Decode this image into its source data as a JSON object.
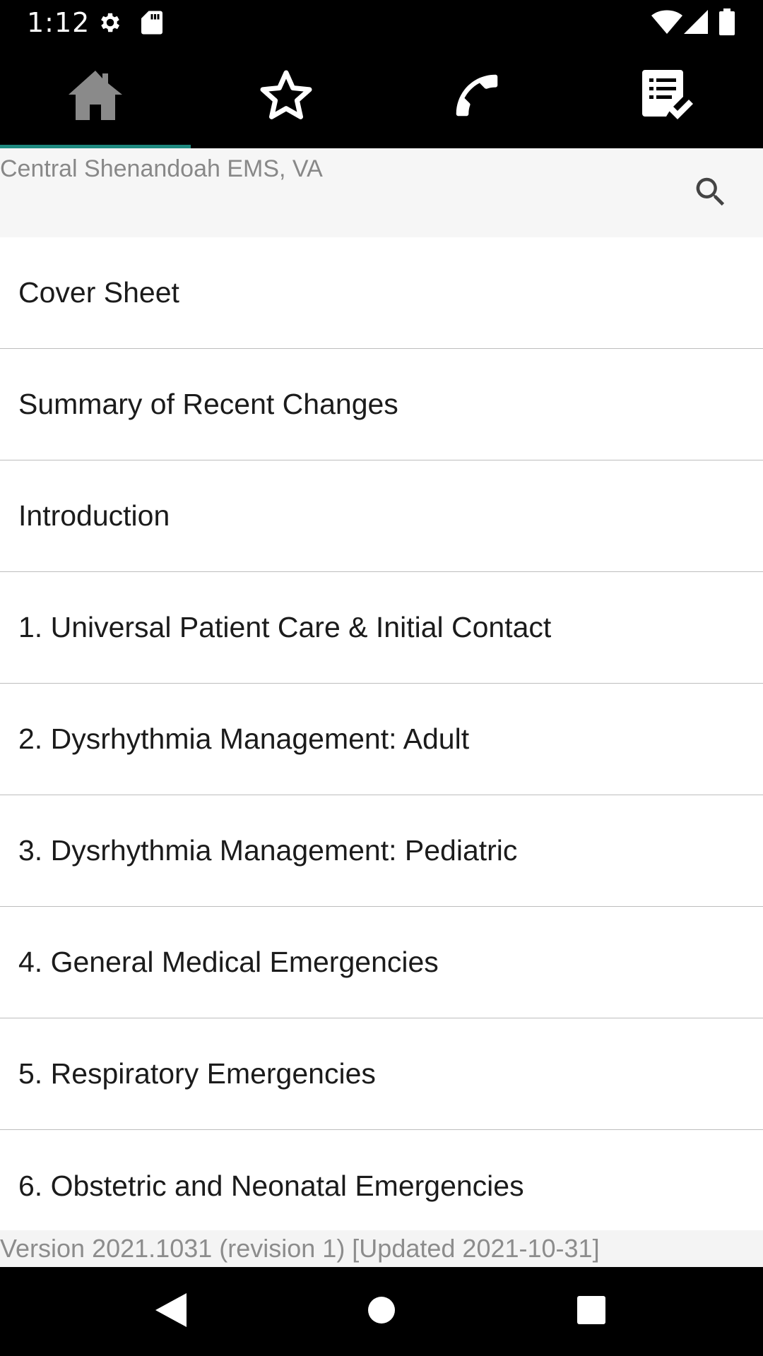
{
  "status_bar": {
    "time": "1:12",
    "icons": [
      "settings-gear-icon",
      "sd-card-icon",
      "wifi-icon",
      "signal-icon",
      "battery-icon"
    ]
  },
  "tabs": [
    {
      "name": "home",
      "icon": "home-icon",
      "selected": true
    },
    {
      "name": "favorites",
      "icon": "star-icon",
      "selected": false
    },
    {
      "name": "contacts",
      "icon": "phone-icon",
      "selected": false
    },
    {
      "name": "checklist",
      "icon": "checklist-icon",
      "selected": false
    }
  ],
  "header": {
    "org_title": "Central Shenandoah EMS, VA",
    "search_icon": "search-icon"
  },
  "toc_items": [
    "Cover Sheet",
    "Summary of Recent Changes",
    "Introduction",
    "1. Universal Patient Care & Initial Contact",
    "2. Dysrhythmia Management: Adult",
    "3. Dysrhythmia Management: Pediatric",
    "4. General Medical Emergencies",
    "5. Respiratory Emergencies",
    "6. Obstetric and Neonatal Emergencies"
  ],
  "footer": {
    "version": "Version 2021.1031 (revision 1) [Updated 2021-10-31]"
  },
  "nav_bar": {
    "buttons": [
      "back-icon",
      "home-circle-icon",
      "recents-icon"
    ]
  },
  "colors": {
    "accent": "#1f8a80",
    "tab_icon_selected": "#8a8a8a",
    "tab_icon": "#ffffff",
    "text": "#1b1b1b",
    "muted_text": "#888888"
  }
}
